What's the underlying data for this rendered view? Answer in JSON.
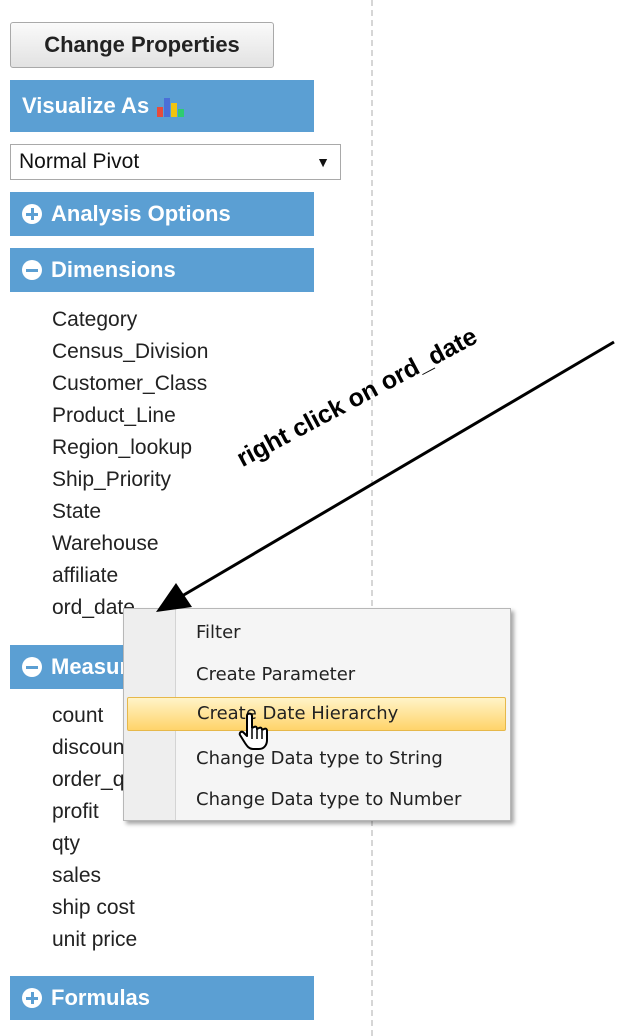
{
  "toolbar": {
    "change_properties": "Change Properties"
  },
  "visualize": {
    "label": "Visualize As",
    "icon": "bar-chart-icon",
    "selected": "Normal Pivot"
  },
  "sections": {
    "analysis_options": "Analysis Options",
    "dimensions": "Dimensions",
    "measures": "Measures",
    "formulas": "Formulas"
  },
  "dimensions": [
    "Category",
    "Census_Division",
    "Customer_Class",
    "Product_Line",
    "Region_lookup",
    "Ship_Priority",
    "State",
    "Warehouse",
    "affiliate",
    "ord_date"
  ],
  "measures": [
    "count",
    "discount",
    "order_qty",
    "profit",
    "qty",
    "sales",
    "ship cost",
    "unit price"
  ],
  "context_menu": {
    "items": [
      "Filter",
      "Create Parameter",
      "Create Date Hierarchy",
      "Change Data type to String",
      "Change Data type to Number"
    ],
    "highlighted": "Create Date Hierarchy"
  },
  "annotation": "right click on ord_date",
  "colors": {
    "section_header": "#5b9fd3",
    "menu_highlight": "#ffd46a"
  }
}
